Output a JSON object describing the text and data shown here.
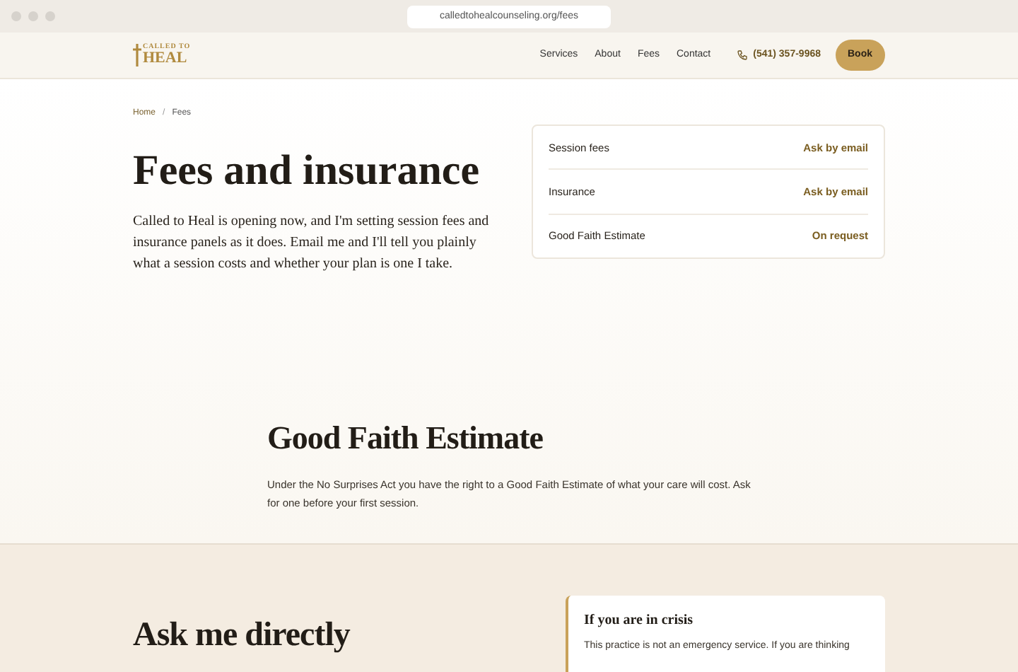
{
  "browser": {
    "url": "calledtohealcounseling.org/fees"
  },
  "header": {
    "logo": {
      "small": "CALLED TO",
      "large": "HEAL"
    },
    "nav": [
      "Services",
      "About",
      "Fees",
      "Contact"
    ],
    "phone": "(541) 357-9968",
    "cta": "Book"
  },
  "breadcrumb": {
    "items": [
      "Home",
      "Fees"
    ],
    "separator": "/"
  },
  "hero": {
    "title": "Fees and insurance",
    "body": "Called to Heal is opening now, and I'm setting session fees and insurance panels as it does. Email me and I'll tell you plainly what a session costs and whether your plan is one I take."
  },
  "fees_card": [
    {
      "label": "Session fees",
      "value": "Ask by email"
    },
    {
      "label": "Insurance",
      "value": "Ask by email"
    },
    {
      "label": "Good Faith Estimate",
      "value": "On request"
    }
  ],
  "gfe": {
    "title": "Good Faith Estimate",
    "body": "Under the No Surprises Act you have the right to a Good Faith Estimate of what your care will cost. Ask for one before your first session."
  },
  "contact": {
    "title": "Ask me directly"
  },
  "crisis": {
    "title": "If you are in crisis",
    "body": "This practice is not an emergency service. If you are thinking"
  }
}
